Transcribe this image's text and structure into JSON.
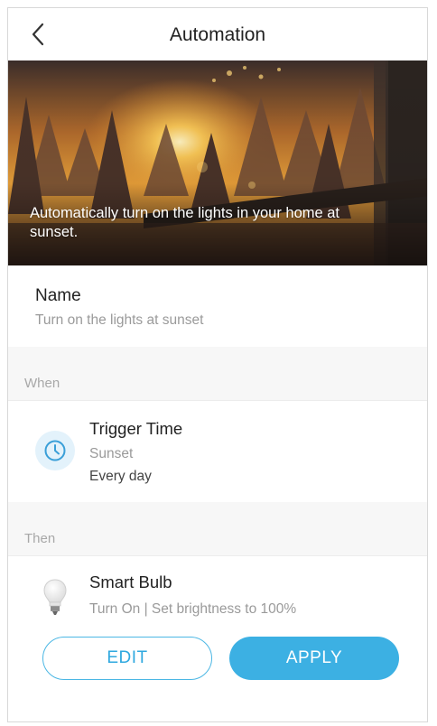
{
  "header": {
    "title": "Automation"
  },
  "hero": {
    "caption": "Automatically turn on the lights in your home at sunset."
  },
  "name": {
    "label": "Name",
    "value": "Turn on the lights at sunset"
  },
  "when": {
    "section_label": "When",
    "trigger": {
      "icon": "clock-icon",
      "title": "Trigger Time",
      "time": "Sunset",
      "repeat": "Every day"
    }
  },
  "then": {
    "section_label": "Then",
    "action": {
      "icon": "light-bulb-icon",
      "device": "Smart Bulb",
      "detail": "Turn On | Set brightness to 100%"
    }
  },
  "buttons": {
    "edit_label": "EDIT",
    "apply_label": "APPLY"
  },
  "colors": {
    "accent": "#3cb0e3",
    "icon_bg": "#e3f2fb",
    "section_bg": "#f7f7f7"
  }
}
